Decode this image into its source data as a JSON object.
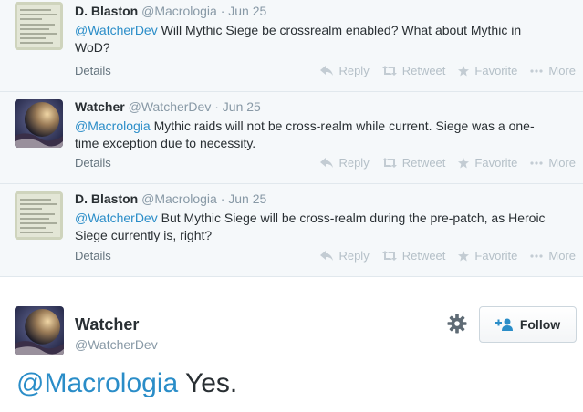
{
  "thread": [
    {
      "fullname": "D. Blaston",
      "screenname": "@Macrologia",
      "sep": "·",
      "date": "Jun 25",
      "mention": "@WatcherDev",
      "text": " Will Mythic Siege be crossrealm enabled? What about Mythic in WoD?",
      "avatar": "notepad-avatar"
    },
    {
      "fullname": "Watcher",
      "screenname": "@WatcherDev",
      "sep": "·",
      "date": "Jun 25",
      "mention": "@Macrologia",
      "text": " Mythic raids will not be cross-realm while current. Siege was a one-time exception due to necessity.",
      "avatar": "planet-avatar"
    },
    {
      "fullname": "D. Blaston",
      "screenname": "@Macrologia",
      "sep": "·",
      "date": "Jun 25",
      "mention": "@WatcherDev",
      "text": " But Mythic Siege will be cross-realm during the pre-patch, as Heroic Siege currently is, right?",
      "avatar": "notepad-avatar"
    }
  ],
  "footer": {
    "details": "Details",
    "reply": "Reply",
    "retweet": "Retweet",
    "favorite": "Favorite",
    "more": "More"
  },
  "main_tweet": {
    "fullname": "Watcher",
    "screenname": "@WatcherDev",
    "follow_label": "Follow",
    "mention": "@Macrologia",
    "text": " Yes."
  },
  "colors": {
    "link": "#2a8dc8",
    "muted": "#8899a6",
    "text": "#292f33"
  }
}
